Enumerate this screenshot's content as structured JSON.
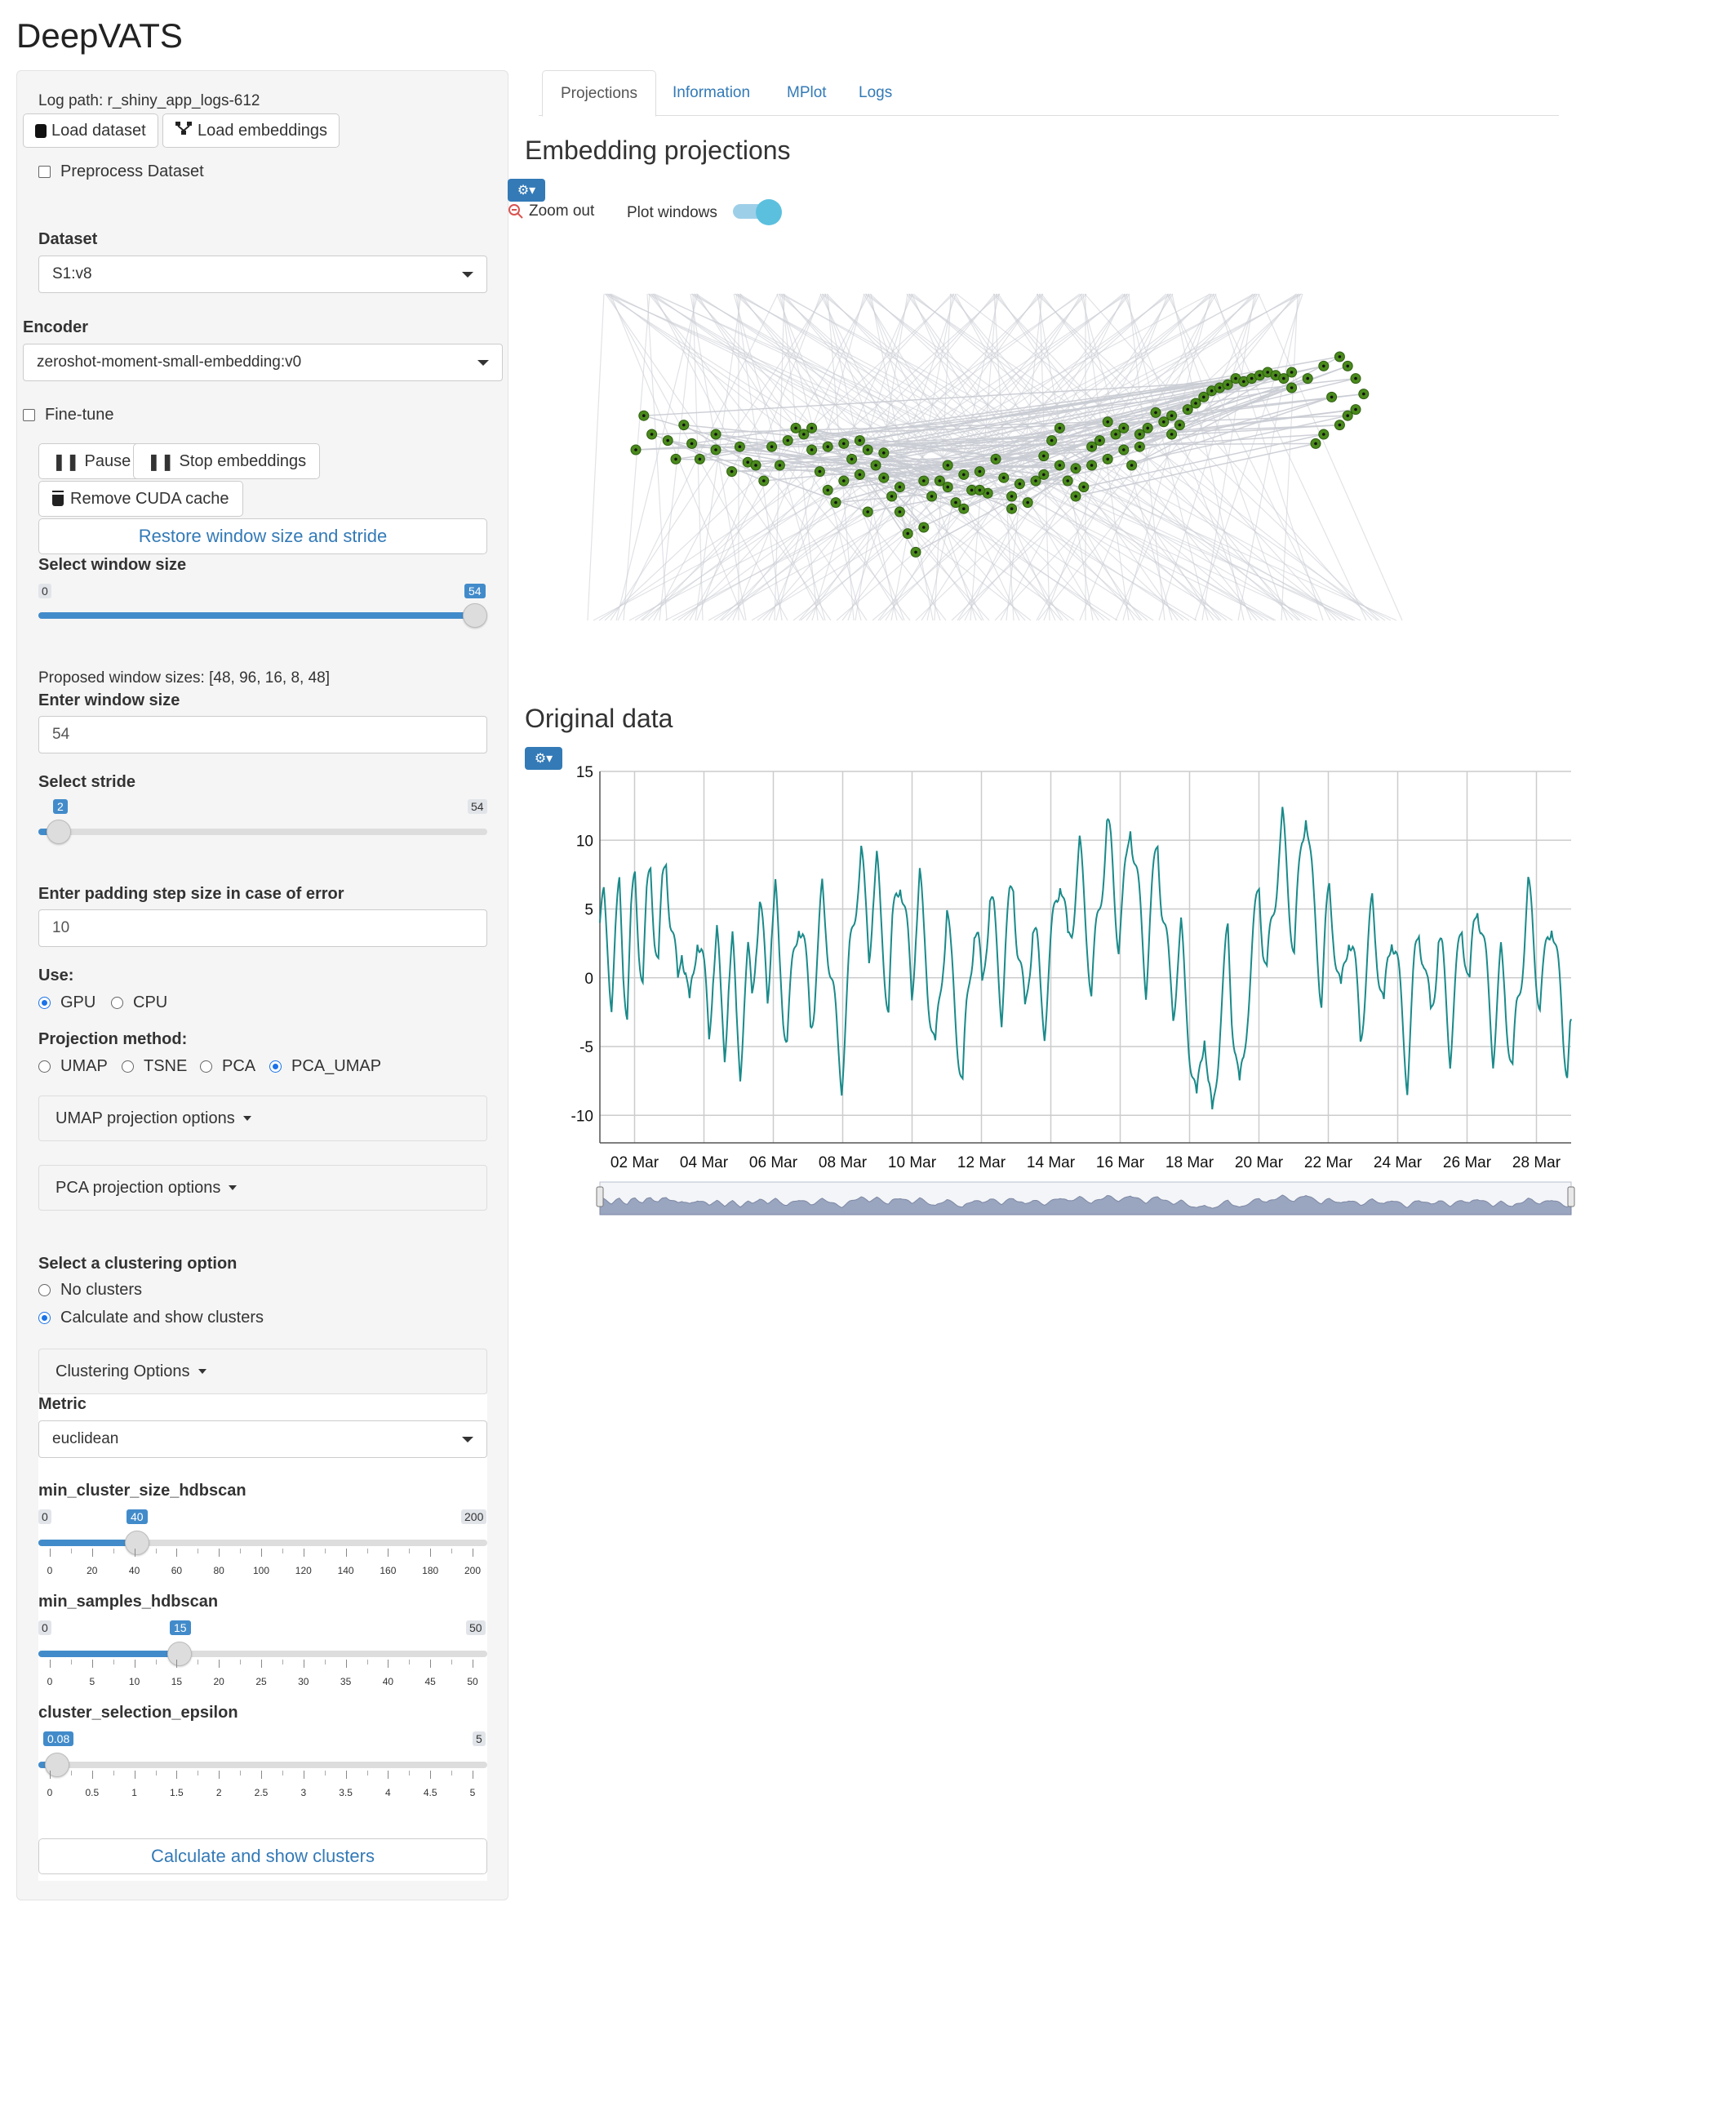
{
  "app": {
    "title": "DeepVATS"
  },
  "sidebar": {
    "log_path": "Log path: r_shiny_app_logs-612",
    "load_dataset": "Load dataset",
    "load_embeddings": "Load embeddings",
    "preprocess": "Preprocess Dataset",
    "dataset_label": "Dataset",
    "dataset_value": "S1:v8",
    "encoder_label": "Encoder",
    "encoder_value": "zeroshot-moment-small-embedding:v0",
    "finetune": "Fine-tune",
    "pause": "Pause",
    "stop_embeddings": "Stop embeddings",
    "remove_cuda": "Remove CUDA cache",
    "restore": "Restore window size and stride",
    "window_size": {
      "label": "Select window size",
      "min": "0",
      "max": "54",
      "value": "54",
      "fraction": 1.0
    },
    "proposed": "Proposed window sizes: [48, 96, 16, 8, 48]",
    "enter_window_label": "Enter window size",
    "enter_window_value": "54",
    "stride": {
      "label": "Select stride",
      "min": "0",
      "max": "54",
      "value": "2",
      "fraction": 0.037
    },
    "padding_label": "Enter padding step size in case of error",
    "padding_value": "10",
    "use_label": "Use:",
    "use_options": [
      "GPU",
      "CPU"
    ],
    "use_selected": "GPU",
    "projection_label": "Projection method:",
    "projection_options": [
      "UMAP",
      "TSNE",
      "PCA",
      "PCA_UMAP"
    ],
    "projection_selected": "PCA_UMAP",
    "umap_options": "UMAP projection options",
    "pca_options": "PCA projection options",
    "clustering_label": "Select a clustering option",
    "clustering_options": [
      "No clusters",
      "Calculate and show clusters"
    ],
    "clustering_selected": "Calculate and show clusters",
    "clustering_panel": "Clustering Options",
    "metric_label": "Metric",
    "metric_value": "euclidean",
    "min_cluster": {
      "label": "min_cluster_size_hdbscan",
      "min": "0",
      "max": "200",
      "value": "40",
      "fraction": 0.2,
      "grid": [
        "0",
        "20",
        "40",
        "60",
        "80",
        "100",
        "120",
        "140",
        "160",
        "180",
        "200"
      ]
    },
    "min_samples": {
      "label": "min_samples_hdbscan",
      "min": "0",
      "max": "50",
      "value": "15",
      "fraction": 0.3,
      "grid": [
        "0",
        "5",
        "10",
        "15",
        "20",
        "25",
        "30",
        "35",
        "40",
        "45",
        "50"
      ]
    },
    "epsilon": {
      "label": "cluster_selection_epsilon",
      "min": "0",
      "max": "5",
      "value": "0.08",
      "fraction": 0.016,
      "grid": [
        "0",
        "0.5",
        "1",
        "1.5",
        "2",
        "2.5",
        "3",
        "3.5",
        "4",
        "4.5",
        "5"
      ]
    },
    "calc_clusters": "Calculate and show clusters"
  },
  "tabs": [
    "Projections",
    "Information",
    "MPlot",
    "Logs"
  ],
  "active_tab": "Projections",
  "projections": {
    "title": "Embedding projections",
    "zoom_out": "Zoom out",
    "plot_windows": "Plot windows",
    "plot_windows_on": true,
    "point_color": "#4a8a1c",
    "line_color": "#c9ccd3"
  },
  "original": {
    "title": "Original data",
    "line_color": "#1a8a8a"
  },
  "chart_data": {
    "type": "line",
    "title": "",
    "xlabel": "",
    "ylabel": "",
    "x_ticks": [
      "02 Mar",
      "04 Mar",
      "06 Mar",
      "08 Mar",
      "10 Mar",
      "12 Mar",
      "14 Mar",
      "16 Mar",
      "18 Mar",
      "20 Mar",
      "22 Mar",
      "24 Mar",
      "26 Mar",
      "28 Mar"
    ],
    "y_ticks": [
      "15",
      "10",
      "5",
      "0",
      "-5",
      "-10"
    ],
    "ylim": [
      -12,
      15
    ],
    "x_start": "2024-03-01",
    "x_end": "2024-03-29",
    "grid": true,
    "series": [
      {
        "values": [
          4,
          5,
          2,
          -1,
          3,
          6,
          1,
          -2,
          4,
          7,
          3,
          0,
          5,
          8,
          4,
          1,
          6,
          9,
          5,
          2,
          -1,
          3,
          1,
          -3,
          0,
          4,
          2,
          -1,
          -4,
          1,
          3,
          -2,
          -5,
          0,
          2,
          -3,
          -6,
          -2,
          1,
          -1,
          3,
          5,
          2,
          -1,
          4,
          6,
          1,
          -2,
          -4,
          -1,
          2,
          5,
          3,
          0,
          -3,
          -1,
          2,
          6,
          4,
          1,
          -2,
          -5,
          -7,
          -3,
          1,
          4,
          7,
          9,
          5,
          2,
          6,
          8,
          4,
          1,
          -2,
          3,
          6,
          8,
          5,
          2,
          -1,
          4,
          7,
          3,
          0,
          -3,
          -6,
          -2,
          2,
          5,
          1,
          -2,
          -5,
          -8,
          -3,
          1,
          4,
          2,
          -1,
          3,
          6,
          4,
          1,
          -2,
          2,
          5,
          7,
          3,
          0,
          -3,
          1,
          4,
          2,
          -1,
          -3,
          0,
          3,
          6,
          8,
          5,
          2,
          4,
          7,
          9,
          6,
          3,
          -1,
          2,
          5,
          8,
          11,
          9,
          6,
          3,
          5,
          8,
          12,
          9,
          6,
          3,
          0,
          4,
          7,
          10,
          6,
          3,
          0,
          -2,
          1,
          3,
          -1,
          -4,
          -7,
          -10,
          -6,
          -3,
          -8,
          -11,
          -7,
          -3,
          0,
          3,
          -2,
          -5,
          -9,
          -6,
          -2,
          1,
          4,
          7,
          3,
          0,
          3,
          6,
          9,
          11,
          8,
          5,
          2,
          6,
          10,
          13,
          9,
          5,
          2,
          -1,
          3,
          6,
          4,
          1,
          -2,
          1,
          4,
          2,
          -1,
          -4,
          -1,
          2,
          5,
          3,
          0,
          -3,
          1,
          4,
          2,
          -1,
          -4,
          -7,
          -3,
          1,
          4,
          2,
          -1,
          -3,
          0,
          3,
          1,
          -2,
          -5,
          -2,
          1,
          4,
          2,
          -1,
          3,
          6,
          4,
          1,
          -2,
          -5,
          -2,
          1,
          -1,
          -4,
          -7,
          -3,
          0,
          3,
          6,
          4,
          1,
          -2,
          0,
          3,
          5,
          2,
          -1,
          -4,
          -6,
          -3
        ]
      }
    ],
    "scatter": {
      "type": "scatter",
      "points": [
        [
          0.05,
          0.55
        ],
        [
          0.07,
          0.6
        ],
        [
          0.09,
          0.58
        ],
        [
          0.11,
          0.63
        ],
        [
          0.12,
          0.57
        ],
        [
          0.13,
          0.52
        ],
        [
          0.15,
          0.55
        ],
        [
          0.17,
          0.48
        ],
        [
          0.19,
          0.51
        ],
        [
          0.21,
          0.45
        ],
        [
          0.23,
          0.5
        ],
        [
          0.24,
          0.58
        ],
        [
          0.26,
          0.6
        ],
        [
          0.27,
          0.55
        ],
        [
          0.28,
          0.48
        ],
        [
          0.29,
          0.42
        ],
        [
          0.3,
          0.38
        ],
        [
          0.31,
          0.45
        ],
        [
          0.32,
          0.52
        ],
        [
          0.33,
          0.58
        ],
        [
          0.34,
          0.55
        ],
        [
          0.35,
          0.5
        ],
        [
          0.36,
          0.46
        ],
        [
          0.37,
          0.4
        ],
        [
          0.38,
          0.35
        ],
        [
          0.39,
          0.28
        ],
        [
          0.4,
          0.22
        ],
        [
          0.41,
          0.3
        ],
        [
          0.42,
          0.4
        ],
        [
          0.43,
          0.45
        ],
        [
          0.44,
          0.43
        ],
        [
          0.45,
          0.38
        ],
        [
          0.46,
          0.36
        ],
        [
          0.47,
          0.42
        ],
        [
          0.48,
          0.48
        ],
        [
          0.5,
          0.52
        ],
        [
          0.51,
          0.46
        ],
        [
          0.52,
          0.4
        ],
        [
          0.54,
          0.38
        ],
        [
          0.55,
          0.45
        ],
        [
          0.56,
          0.53
        ],
        [
          0.57,
          0.58
        ],
        [
          0.58,
          0.5
        ],
        [
          0.59,
          0.45
        ],
        [
          0.6,
          0.4
        ],
        [
          0.61,
          0.43
        ],
        [
          0.62,
          0.5
        ],
        [
          0.63,
          0.58
        ],
        [
          0.64,
          0.64
        ],
        [
          0.65,
          0.6
        ],
        [
          0.66,
          0.55
        ],
        [
          0.67,
          0.5
        ],
        [
          0.68,
          0.56
        ],
        [
          0.69,
          0.62
        ],
        [
          0.7,
          0.67
        ],
        [
          0.71,
          0.64
        ],
        [
          0.72,
          0.6
        ],
        [
          0.73,
          0.63
        ],
        [
          0.74,
          0.68
        ],
        [
          0.75,
          0.7
        ],
        [
          0.76,
          0.72
        ],
        [
          0.77,
          0.74
        ],
        [
          0.78,
          0.75
        ],
        [
          0.79,
          0.76
        ],
        [
          0.8,
          0.78
        ],
        [
          0.81,
          0.77
        ],
        [
          0.82,
          0.78
        ],
        [
          0.83,
          0.79
        ],
        [
          0.84,
          0.8
        ],
        [
          0.85,
          0.79
        ],
        [
          0.86,
          0.78
        ],
        [
          0.87,
          0.8
        ],
        [
          0.89,
          0.78
        ],
        [
          0.91,
          0.82
        ],
        [
          0.93,
          0.85
        ],
        [
          0.94,
          0.82
        ],
        [
          0.95,
          0.78
        ],
        [
          0.96,
          0.73
        ],
        [
          0.95,
          0.68
        ],
        [
          0.93,
          0.63
        ],
        [
          0.91,
          0.6
        ],
        [
          0.9,
          0.57
        ],
        [
          0.22,
          0.56
        ],
        [
          0.25,
          0.62
        ],
        [
          0.29,
          0.56
        ],
        [
          0.33,
          0.47
        ],
        [
          0.34,
          0.35
        ],
        [
          0.38,
          0.43
        ],
        [
          0.49,
          0.41
        ],
        [
          0.53,
          0.44
        ],
        [
          0.58,
          0.62
        ],
        [
          0.62,
          0.56
        ],
        [
          0.66,
          0.62
        ],
        [
          0.06,
          0.66
        ],
        [
          0.1,
          0.52
        ],
        [
          0.15,
          0.6
        ],
        [
          0.18,
          0.56
        ],
        [
          0.2,
          0.5
        ],
        [
          0.27,
          0.62
        ],
        [
          0.31,
          0.57
        ],
        [
          0.36,
          0.54
        ],
        [
          0.41,
          0.45
        ],
        [
          0.44,
          0.5
        ],
        [
          0.46,
          0.47
        ],
        [
          0.48,
          0.42
        ],
        [
          0.52,
          0.36
        ],
        [
          0.56,
          0.47
        ],
        [
          0.6,
          0.49
        ],
        [
          0.64,
          0.52
        ],
        [
          0.68,
          0.6
        ],
        [
          0.72,
          0.66
        ],
        [
          0.87,
          0.75
        ],
        [
          0.92,
          0.72
        ],
        [
          0.94,
          0.66
        ]
      ]
    }
  }
}
